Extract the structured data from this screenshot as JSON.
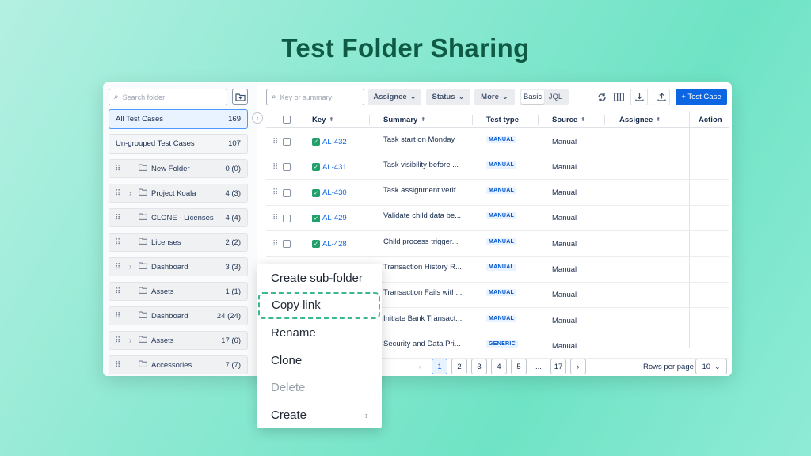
{
  "headline": "Test Folder Sharing",
  "left_panel": {
    "search_placeholder": "Search folder",
    "all_test_cases": {
      "label": "All Test Cases",
      "count": "169"
    },
    "ungrouped": {
      "label": "Un-grouped Test Cases",
      "count": "107"
    },
    "folders": [
      {
        "name": "New Folder",
        "count": "0 (0)",
        "expandable": false
      },
      {
        "name": "Project Koala",
        "count": "4 (3)",
        "expandable": true
      },
      {
        "name": "CLONE - Licenses",
        "count": "4 (4)",
        "expandable": false
      },
      {
        "name": "Licenses",
        "count": "2 (2)",
        "expandable": false
      },
      {
        "name": "Dashboard",
        "count": "3 (3)",
        "expandable": true
      },
      {
        "name": "Assets",
        "count": "1 (1)",
        "expandable": false
      },
      {
        "name": "Dashboard",
        "count": "24 (24)",
        "expandable": false
      },
      {
        "name": "Assets",
        "count": "17 (6)",
        "expandable": true
      },
      {
        "name": "Accessories",
        "count": "7 (7)",
        "expandable": false
      }
    ]
  },
  "toolbar": {
    "search_placeholder": "Key or summary",
    "assignee": "Assignee",
    "status": "Status",
    "more": "More",
    "basic": "Basic",
    "jql": "JQL",
    "new_test_case": "+ Test Case"
  },
  "table": {
    "headers": {
      "key": "Key",
      "summary": "Summary",
      "test_type": "Test type",
      "source": "Source",
      "assignee": "Assignee",
      "action": "Action"
    },
    "rows": [
      {
        "key": "AL-432",
        "summary": "Task start on Monday",
        "type": "MANUAL",
        "source": "Manual"
      },
      {
        "key": "AL-431",
        "summary": "Task visibility before ...",
        "type": "MANUAL",
        "source": "Manual"
      },
      {
        "key": "AL-430",
        "summary": "Task assignment verif...",
        "type": "MANUAL",
        "source": "Manual"
      },
      {
        "key": "AL-429",
        "summary": "Validate child data be...",
        "type": "MANUAL",
        "source": "Manual"
      },
      {
        "key": "AL-428",
        "summary": "Child process trigger...",
        "type": "MANUAL",
        "source": "Manual"
      },
      {
        "key": "",
        "summary": "Transaction History R...",
        "type": "MANUAL",
        "source": "Manual"
      },
      {
        "key": "",
        "summary": "Transaction Fails with...",
        "type": "MANUAL",
        "source": "Manual"
      },
      {
        "key": "",
        "summary": "Initiate Bank Transact...",
        "type": "MANUAL",
        "source": "Manual"
      },
      {
        "key": "",
        "summary": "Security and Data Pri...",
        "type": "GENERIC",
        "source": "Manual"
      }
    ]
  },
  "pagination": {
    "pages": [
      "1",
      "2",
      "3",
      "4",
      "5",
      "...",
      "17"
    ],
    "prev": "‹",
    "next": "›",
    "rows_per_page_label": "Rows per page",
    "rows_per_page_value": "10"
  },
  "context_menu": {
    "items": [
      {
        "label": "Create sub-folder",
        "state": "normal"
      },
      {
        "label": "Copy link",
        "state": "highlight"
      },
      {
        "label": "Rename",
        "state": "normal"
      },
      {
        "label": "Clone",
        "state": "normal"
      },
      {
        "label": "Delete",
        "state": "disabled"
      },
      {
        "label": "Create",
        "state": "submenu"
      }
    ]
  },
  "colors": {
    "accent": "#0c66e4",
    "highlight": "#3cb88f",
    "headline": "#0e5a44"
  }
}
